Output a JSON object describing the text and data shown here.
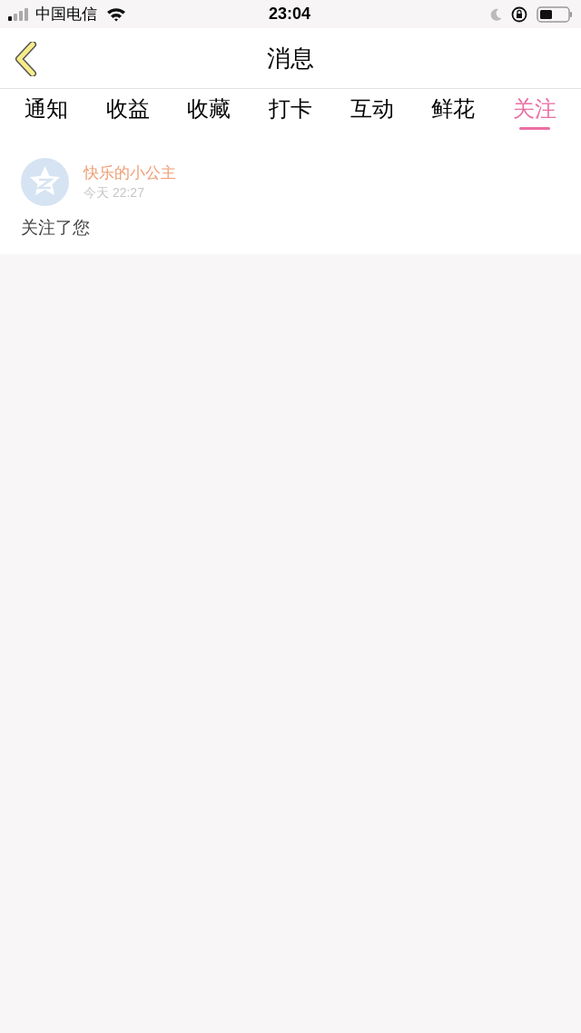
{
  "status_bar": {
    "carrier": "中国电信",
    "time": "23:04"
  },
  "header": {
    "title": "消息"
  },
  "tabs": [
    {
      "label": "通知",
      "selected": false
    },
    {
      "label": "收益",
      "selected": false
    },
    {
      "label": "收藏",
      "selected": false
    },
    {
      "label": "打卡",
      "selected": false
    },
    {
      "label": "互动",
      "selected": false
    },
    {
      "label": "鲜花",
      "selected": false
    },
    {
      "label": "关注",
      "selected": true
    }
  ],
  "messages": [
    {
      "name": "快乐的小公主",
      "time": "今天 22:27",
      "text": "关注了您"
    }
  ]
}
